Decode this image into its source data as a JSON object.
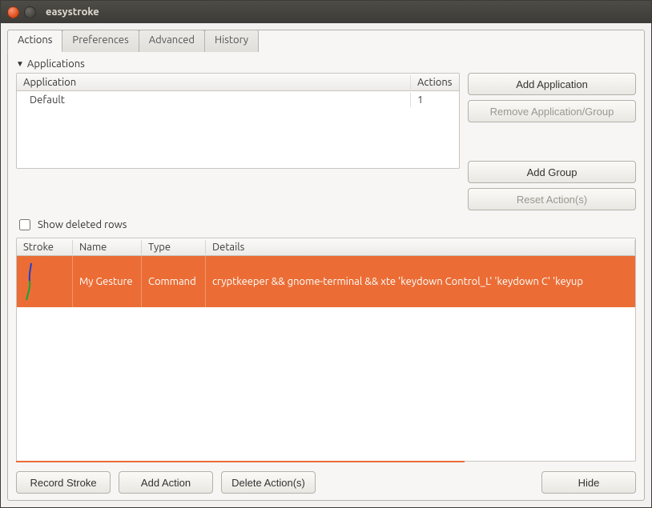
{
  "window": {
    "title": "easystroke"
  },
  "tabs": [
    {
      "label": "Actions",
      "active": true
    },
    {
      "label": "Preferences",
      "active": false
    },
    {
      "label": "Advanced",
      "active": false
    },
    {
      "label": "History",
      "active": false
    }
  ],
  "applications": {
    "title": "Applications",
    "columns": {
      "application": "Application",
      "actions": "Actions"
    },
    "rows": [
      {
        "application": "Default",
        "actions": "1"
      }
    ]
  },
  "side_buttons": {
    "add_application": "Add Application",
    "remove_application": "Remove Application/Group",
    "add_group": "Add Group",
    "reset_actions": "Reset Action(s)"
  },
  "show_deleted": {
    "label": "Show deleted rows",
    "checked": false
  },
  "actions_table": {
    "columns": {
      "stroke": "Stroke",
      "name": "Name",
      "type": "Type",
      "details": "Details"
    },
    "rows": [
      {
        "name": "My Gesture",
        "type": "Command",
        "details": "cryptkeeper && gnome-terminal && xte 'keydown Control_L' 'keydown C' 'keyup",
        "selected": true
      }
    ]
  },
  "bottom": {
    "record_stroke": "Record Stroke",
    "add_action": "Add Action",
    "delete_actions": "Delete Action(s)",
    "hide": "Hide"
  }
}
